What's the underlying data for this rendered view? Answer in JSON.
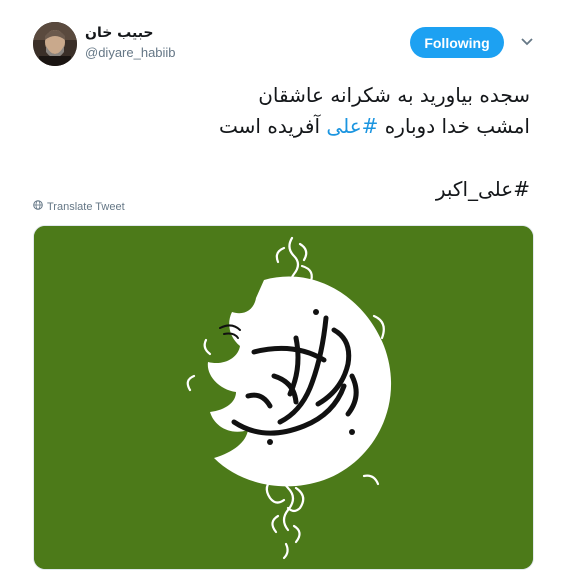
{
  "user": {
    "display_name": "حبیب خان",
    "handle": "@diyare_habiib"
  },
  "actions": {
    "follow_label": "Following",
    "caret_icon": "chevron-down-icon"
  },
  "tweet": {
    "line1": "سجده بیاورید به شکرانه عاشقان",
    "line2_after": " آفریده است",
    "line2_hashtag": "#علی",
    "line2_before": "امشب خدا دوباره ",
    "hashtag2": "#علی_اکبر",
    "translate_label": "Translate Tweet",
    "translate_icon": "globe-icon"
  },
  "media": {
    "background_color": "#4c7a19",
    "calligraphy_main": "حضرت علی اکبر",
    "calligraphy_small": "علیه السلام"
  },
  "colors": {
    "accent": "#1da1f2",
    "link": "#1b95e0",
    "muted": "#657786"
  }
}
